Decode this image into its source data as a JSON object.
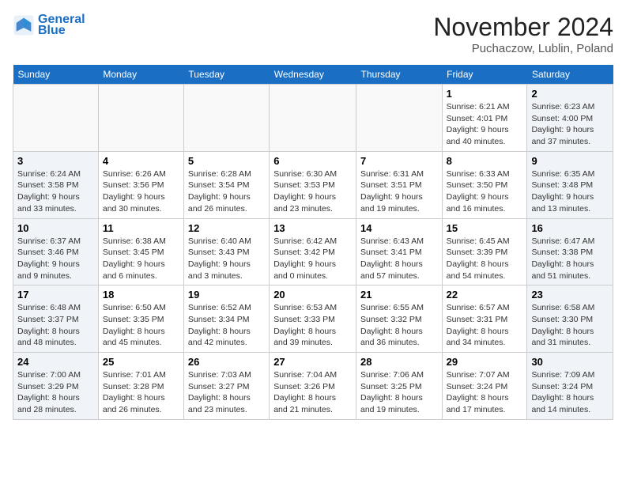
{
  "header": {
    "logo_line1": "General",
    "logo_line2": "Blue",
    "month": "November 2024",
    "location": "Puchaczow, Lublin, Poland"
  },
  "weekdays": [
    "Sunday",
    "Monday",
    "Tuesday",
    "Wednesday",
    "Thursday",
    "Friday",
    "Saturday"
  ],
  "weeks": [
    [
      {
        "day": "",
        "info": ""
      },
      {
        "day": "",
        "info": ""
      },
      {
        "day": "",
        "info": ""
      },
      {
        "day": "",
        "info": ""
      },
      {
        "day": "",
        "info": ""
      },
      {
        "day": "1",
        "info": "Sunrise: 6:21 AM\nSunset: 4:01 PM\nDaylight: 9 hours\nand 40 minutes."
      },
      {
        "day": "2",
        "info": "Sunrise: 6:23 AM\nSunset: 4:00 PM\nDaylight: 9 hours\nand 37 minutes."
      }
    ],
    [
      {
        "day": "3",
        "info": "Sunrise: 6:24 AM\nSunset: 3:58 PM\nDaylight: 9 hours\nand 33 minutes."
      },
      {
        "day": "4",
        "info": "Sunrise: 6:26 AM\nSunset: 3:56 PM\nDaylight: 9 hours\nand 30 minutes."
      },
      {
        "day": "5",
        "info": "Sunrise: 6:28 AM\nSunset: 3:54 PM\nDaylight: 9 hours\nand 26 minutes."
      },
      {
        "day": "6",
        "info": "Sunrise: 6:30 AM\nSunset: 3:53 PM\nDaylight: 9 hours\nand 23 minutes."
      },
      {
        "day": "7",
        "info": "Sunrise: 6:31 AM\nSunset: 3:51 PM\nDaylight: 9 hours\nand 19 minutes."
      },
      {
        "day": "8",
        "info": "Sunrise: 6:33 AM\nSunset: 3:50 PM\nDaylight: 9 hours\nand 16 minutes."
      },
      {
        "day": "9",
        "info": "Sunrise: 6:35 AM\nSunset: 3:48 PM\nDaylight: 9 hours\nand 13 minutes."
      }
    ],
    [
      {
        "day": "10",
        "info": "Sunrise: 6:37 AM\nSunset: 3:46 PM\nDaylight: 9 hours\nand 9 minutes."
      },
      {
        "day": "11",
        "info": "Sunrise: 6:38 AM\nSunset: 3:45 PM\nDaylight: 9 hours\nand 6 minutes."
      },
      {
        "day": "12",
        "info": "Sunrise: 6:40 AM\nSunset: 3:43 PM\nDaylight: 9 hours\nand 3 minutes."
      },
      {
        "day": "13",
        "info": "Sunrise: 6:42 AM\nSunset: 3:42 PM\nDaylight: 9 hours\nand 0 minutes."
      },
      {
        "day": "14",
        "info": "Sunrise: 6:43 AM\nSunset: 3:41 PM\nDaylight: 8 hours\nand 57 minutes."
      },
      {
        "day": "15",
        "info": "Sunrise: 6:45 AM\nSunset: 3:39 PM\nDaylight: 8 hours\nand 54 minutes."
      },
      {
        "day": "16",
        "info": "Sunrise: 6:47 AM\nSunset: 3:38 PM\nDaylight: 8 hours\nand 51 minutes."
      }
    ],
    [
      {
        "day": "17",
        "info": "Sunrise: 6:48 AM\nSunset: 3:37 PM\nDaylight: 8 hours\nand 48 minutes."
      },
      {
        "day": "18",
        "info": "Sunrise: 6:50 AM\nSunset: 3:35 PM\nDaylight: 8 hours\nand 45 minutes."
      },
      {
        "day": "19",
        "info": "Sunrise: 6:52 AM\nSunset: 3:34 PM\nDaylight: 8 hours\nand 42 minutes."
      },
      {
        "day": "20",
        "info": "Sunrise: 6:53 AM\nSunset: 3:33 PM\nDaylight: 8 hours\nand 39 minutes."
      },
      {
        "day": "21",
        "info": "Sunrise: 6:55 AM\nSunset: 3:32 PM\nDaylight: 8 hours\nand 36 minutes."
      },
      {
        "day": "22",
        "info": "Sunrise: 6:57 AM\nSunset: 3:31 PM\nDaylight: 8 hours\nand 34 minutes."
      },
      {
        "day": "23",
        "info": "Sunrise: 6:58 AM\nSunset: 3:30 PM\nDaylight: 8 hours\nand 31 minutes."
      }
    ],
    [
      {
        "day": "24",
        "info": "Sunrise: 7:00 AM\nSunset: 3:29 PM\nDaylight: 8 hours\nand 28 minutes."
      },
      {
        "day": "25",
        "info": "Sunrise: 7:01 AM\nSunset: 3:28 PM\nDaylight: 8 hours\nand 26 minutes."
      },
      {
        "day": "26",
        "info": "Sunrise: 7:03 AM\nSunset: 3:27 PM\nDaylight: 8 hours\nand 23 minutes."
      },
      {
        "day": "27",
        "info": "Sunrise: 7:04 AM\nSunset: 3:26 PM\nDaylight: 8 hours\nand 21 minutes."
      },
      {
        "day": "28",
        "info": "Sunrise: 7:06 AM\nSunset: 3:25 PM\nDaylight: 8 hours\nand 19 minutes."
      },
      {
        "day": "29",
        "info": "Sunrise: 7:07 AM\nSunset: 3:24 PM\nDaylight: 8 hours\nand 17 minutes."
      },
      {
        "day": "30",
        "info": "Sunrise: 7:09 AM\nSunset: 3:24 PM\nDaylight: 8 hours\nand 14 minutes."
      }
    ]
  ]
}
